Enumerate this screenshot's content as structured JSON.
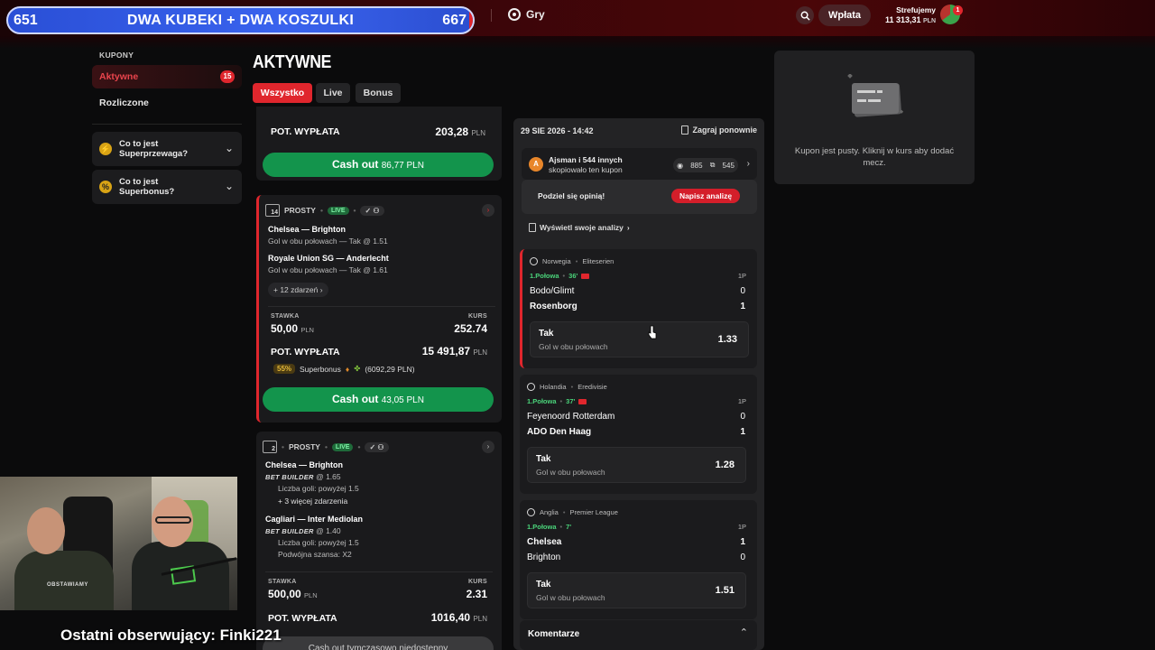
{
  "header": {
    "goal_left": "651",
    "goal_title": "DWA KUBEKI + DWA KOSZULKI",
    "goal_right": "667",
    "nav_games": "Gry",
    "deposit": "Wpłata",
    "account_name": "Strefujemy",
    "account_balance": "11 313,31",
    "currency": "PLN",
    "notifications": "1"
  },
  "sidebar": {
    "section_title": "KUPONY",
    "items": [
      {
        "label": "Aktywne",
        "badge": "15"
      },
      {
        "label": "Rozliczone"
      }
    ],
    "info": [
      {
        "label": "Co to jest Superprzewaga?"
      },
      {
        "label": "Co to jest Superbonus?"
      }
    ]
  },
  "main": {
    "title": "AKTYWNE",
    "tabs": [
      "Wszystko",
      "Live",
      "Bonus"
    ]
  },
  "coupons": [
    {
      "payout_label": "POT. WYPŁATA",
      "payout": "203,28",
      "cashout_label": "Cash out",
      "cashout_value": "86,77 PLN"
    },
    {
      "count": "14",
      "type": "PROSTY",
      "live": "LIVE",
      "selections": [
        {
          "match": "Chelsea — Brighton",
          "market": "Gol w obu połowach — Tak @ 1.51"
        },
        {
          "match": "Royale Union SG — Anderlecht",
          "market": "Gol w obu połowach — Tak @ 1.61"
        }
      ],
      "more": "+ 12 zdarzeń",
      "stake_label": "STAWKA",
      "stake": "50,00",
      "odds_label": "KURS",
      "odds": "252.74",
      "payout_label": "POT. WYPŁATA",
      "payout": "15 491,87",
      "superbonus_pct": "55%",
      "superbonus_label": "Superbonus",
      "superbonus_value": "(6092,29 PLN)",
      "cashout_label": "Cash out",
      "cashout_value": "43,05 PLN"
    },
    {
      "count": "2",
      "type": "PROSTY",
      "live": "LIVE",
      "selections": [
        {
          "match": "Chelsea — Brighton",
          "bb": "BET BUILDER",
          "odds": "@ 1.65",
          "legs": [
            "Liczba goli: powyżej 1.5",
            "+ 3 więcej zdarzenia"
          ]
        },
        {
          "match": "Cagliari — Inter Mediolan",
          "bb": "BET BUILDER",
          "odds": "@ 1.40",
          "legs": [
            "Liczba goli: powyżej 1.5",
            "Podwójna szansa: X2"
          ]
        }
      ],
      "stake_label": "STAWKA",
      "stake": "500,00",
      "odds_label": "KURS",
      "odds": "2.31",
      "payout_label": "POT. WYPŁATA",
      "payout": "1016,40",
      "cashout_label": "Cash out tymczasowo niedostępny"
    }
  ],
  "detail": {
    "date": "29 SIE 2026 - 14:42",
    "replay": "Zagraj ponownie",
    "avatar_letter": "A",
    "share_name": "Ajsman i 544 innych",
    "share_sub": "skopiowało ten kupon",
    "views": "885",
    "copies": "545",
    "opinion_q": "Podziel się opinią!",
    "opinion_btn": "Napisz analizę",
    "analyses": "Wyświetl swoje analizy",
    "events": [
      {
        "country": "Norwegia",
        "league": "Eliteserien",
        "period": "1.Połowa",
        "minute": "36'",
        "col": "1P",
        "home": "Bodo/Glimt",
        "home_score": "0",
        "away": "Rosenborg",
        "away_score": "1",
        "pick": "Tak",
        "market": "Gol w obu połowach",
        "odd": "1.33"
      },
      {
        "country": "Holandia",
        "league": "Eredivisie",
        "period": "1.Połowa",
        "minute": "37'",
        "col": "1P",
        "home": "Feyenoord Rotterdam",
        "home_score": "0",
        "away": "ADO Den Haag",
        "away_score": "1",
        "pick": "Tak",
        "market": "Gol w obu połowach",
        "odd": "1.28"
      },
      {
        "country": "Anglia",
        "league": "Premier League",
        "period": "1.Połowa",
        "minute": "7'",
        "col": "1P",
        "home": "Chelsea",
        "home_score": "1",
        "away": "Brighton",
        "away_score": "0",
        "pick": "Tak",
        "market": "Gol w obu połowach",
        "odd": "1.51"
      }
    ],
    "comments": "Komentarze"
  },
  "betslip": {
    "empty_msg": "Kupon jest pusty. Kliknij w kurs aby dodać mecz."
  },
  "overlay": {
    "follower": "Ostatni obserwujący: Finki221",
    "shirt_text": "OBSTAWIAMY"
  },
  "colors": {
    "accent": "#e0262d",
    "cashout": "#13944c",
    "live_green": "#4ad37a"
  }
}
